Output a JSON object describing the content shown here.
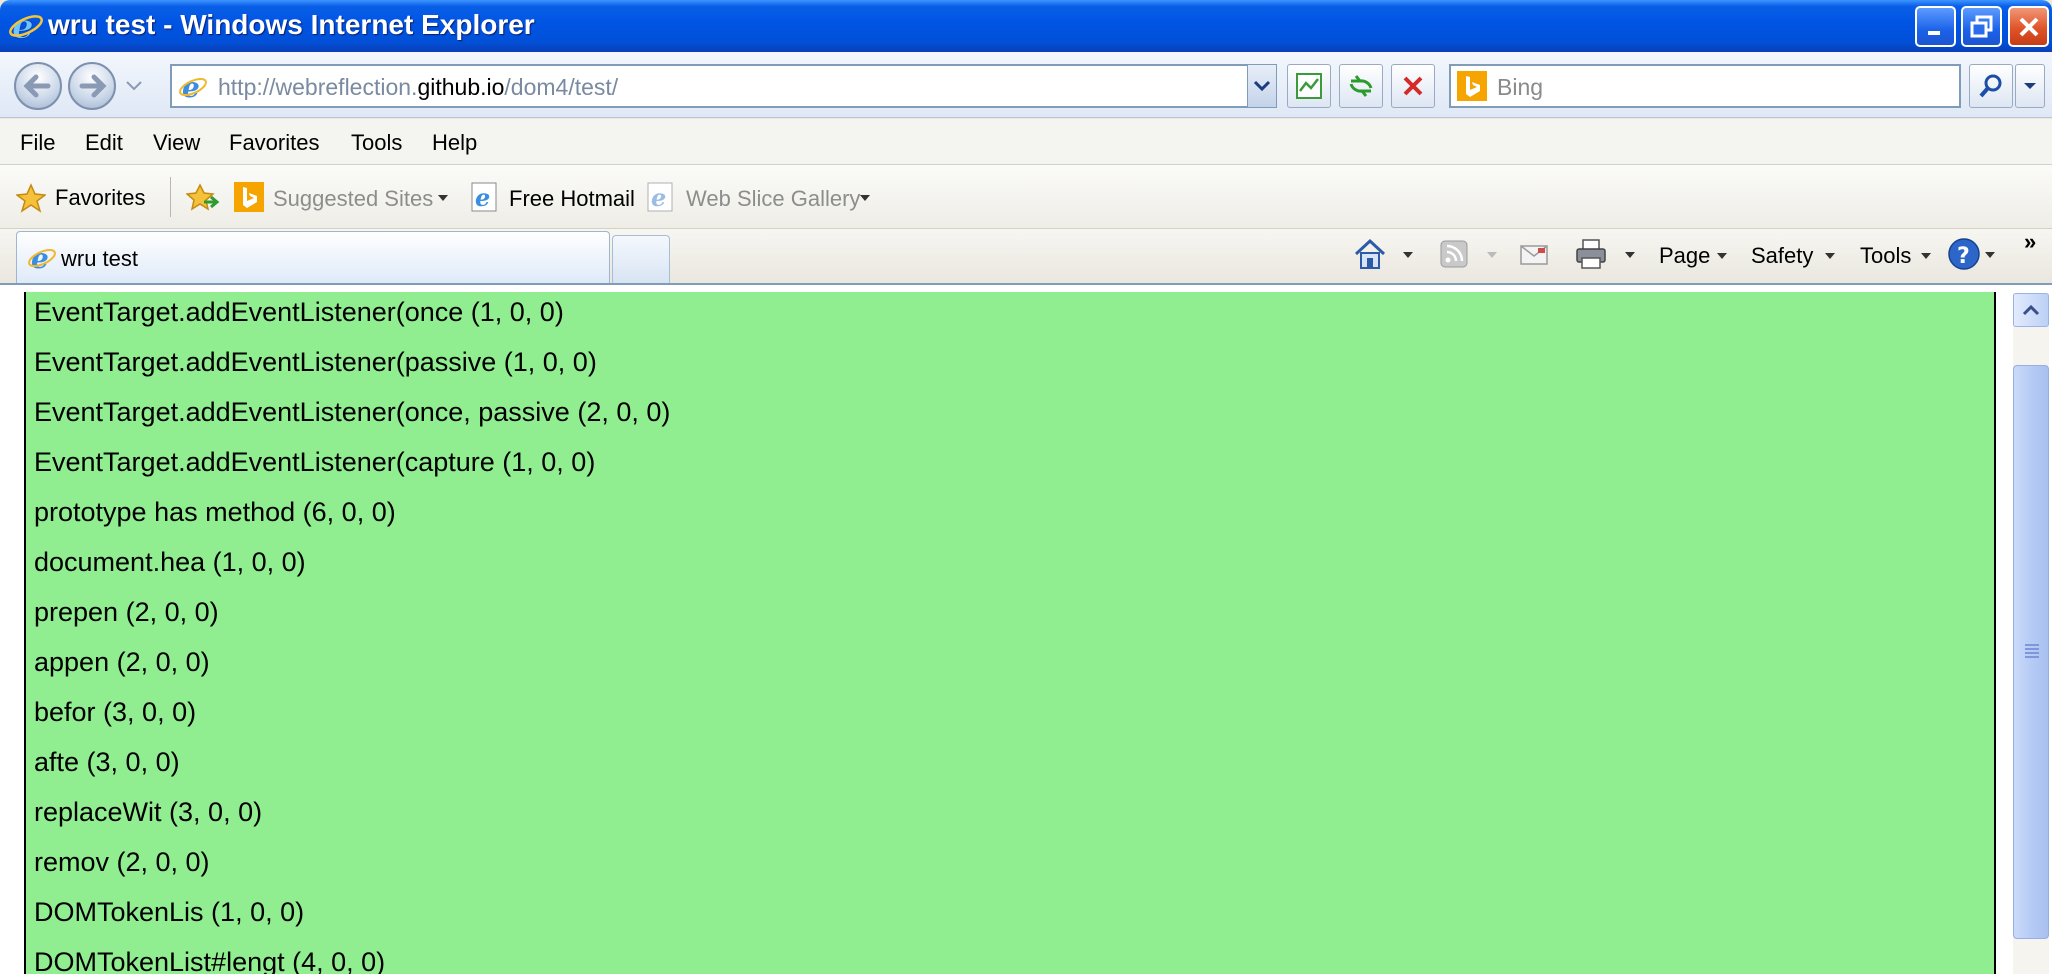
{
  "window": {
    "title": "wru test - Windows Internet Explorer"
  },
  "address": {
    "url_prefix": "http://webreflection.",
    "url_domain": "github.io",
    "url_suffix": "/dom4/test/"
  },
  "search": {
    "placeholder": "Bing"
  },
  "menu": {
    "items": [
      "File",
      "Edit",
      "View",
      "Favorites",
      "Tools",
      "Help"
    ]
  },
  "favorites_bar": {
    "favorites_label": "Favorites",
    "suggested_sites": "Suggested Sites",
    "free_hotmail": "Free Hotmail",
    "web_slice_gallery": "Web Slice Gallery"
  },
  "tabs": {
    "active_label": "wru test"
  },
  "command_bar": {
    "page": "Page",
    "safety": "Safety",
    "tools": "Tools",
    "overflow": "»"
  },
  "results": [
    "EventTarget.addEventListener(once (1, 0, 0)",
    "EventTarget.addEventListener(passive (1, 0, 0)",
    "EventTarget.addEventListener(once, passive (2, 0, 0)",
    "EventTarget.addEventListener(capture (1, 0, 0)",
    "prototype has method (6, 0, 0)",
    "document.hea (1, 0, 0)",
    "prepen (2, 0, 0)",
    "appen (2, 0, 0)",
    "befor (3, 0, 0)",
    "afte (3, 0, 0)",
    "replaceWit (3, 0, 0)",
    "remov (2, 0, 0)",
    "DOMTokenLis (1, 0, 0)",
    "DOMTokenList#lengt (4, 0, 0)"
  ],
  "colors": {
    "result_background": "#90ee90",
    "titlebar_blue": "#0054e3"
  }
}
